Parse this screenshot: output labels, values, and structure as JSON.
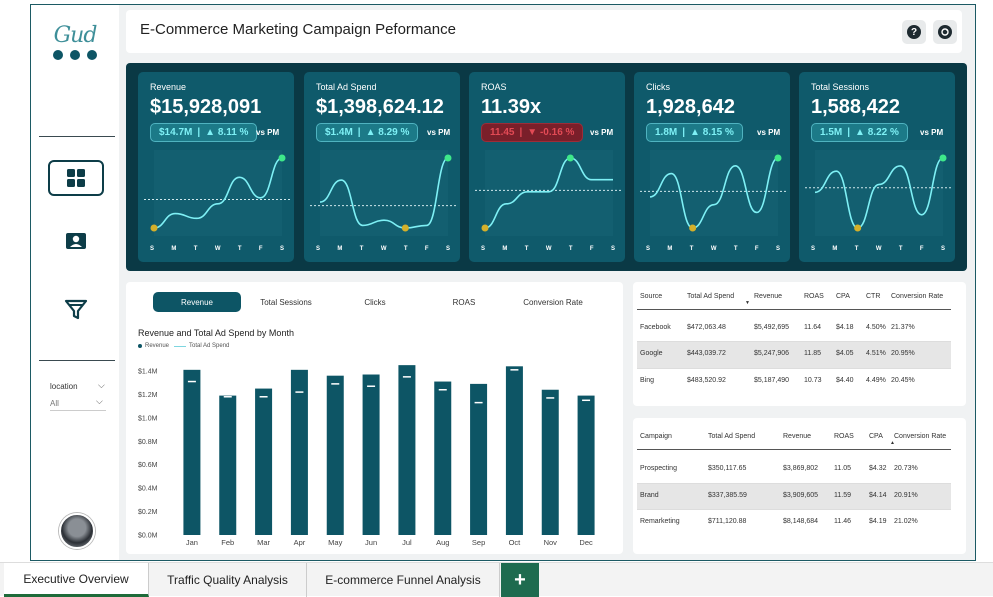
{
  "header": {
    "title": "E-Commerce Marketing Campaign Peformance",
    "help_icon": "?",
    "sync_icon": "sync"
  },
  "sidebar": {
    "logo_text": "Gud",
    "nav": [
      "dashboard-grid-icon",
      "profile-card-icon",
      "funnel-icon"
    ],
    "filter": {
      "label": "location",
      "value": "All"
    }
  },
  "kpis": [
    {
      "title": "Revenue",
      "value": "$15,928,091",
      "prev": "$14.7M",
      "change": "▲ 8.11 %",
      "vs": "vs PM",
      "trend": "positive",
      "series": [
        40,
        52,
        48,
        60,
        82,
        65,
        98
      ]
    },
    {
      "title": "Total Ad Spend",
      "value": "$1,398,624.12",
      "prev": "$1.4M",
      "change": "▲ 8.29 %",
      "vs": "vs PM",
      "trend": "positive",
      "series": [
        58,
        75,
        40,
        44,
        38,
        40,
        92
      ]
    },
    {
      "title": "ROAS",
      "value": "11.39x",
      "prev": "11.45",
      "change": "▼ -0.16 %",
      "vs": "vs PM",
      "trend": "negative",
      "series": [
        40,
        60,
        70,
        70,
        98,
        80,
        80
      ]
    },
    {
      "title": "Clicks",
      "value": "1,928,642",
      "prev": "1.8M",
      "change": "▲ 8.15 %",
      "vs": "vs PM",
      "trend": "positive",
      "series": [
        70,
        85,
        50,
        65,
        90,
        60,
        95
      ]
    },
    {
      "title": "Total Sessions",
      "value": "1,588,422",
      "prev": "1.5M",
      "change": "▲ 8.22 %",
      "vs": "vs PM",
      "trend": "positive",
      "series": [
        72,
        88,
        45,
        78,
        92,
        55,
        98
      ]
    }
  ],
  "days": [
    "S",
    "M",
    "T",
    "W",
    "T",
    "F",
    "S"
  ],
  "chart_tabs": [
    "Revenue",
    "Total Sessions",
    "Clicks",
    "ROAS",
    "Conversion Rate"
  ],
  "chart_data": {
    "type": "bar",
    "title": "Revenue and Total Ad Spend by Month",
    "legend": [
      "Revenue",
      "Total Ad Spend"
    ],
    "categories": [
      "Jan",
      "Feb",
      "Mar",
      "Apr",
      "May",
      "Jun",
      "Jul",
      "Aug",
      "Sep",
      "Oct",
      "Nov",
      "Dec"
    ],
    "series": [
      {
        "name": "Revenue",
        "values": [
          1.41,
          1.19,
          1.25,
          1.41,
          1.36,
          1.37,
          1.45,
          1.31,
          1.29,
          1.44,
          1.24,
          1.19
        ]
      },
      {
        "name": "Total Ad Spend",
        "values": [
          1.31,
          1.18,
          1.18,
          1.22,
          1.29,
          1.27,
          1.35,
          1.24,
          1.13,
          1.41,
          1.17,
          1.15
        ]
      }
    ],
    "yticks": [
      "$0.0M",
      "$0.2M",
      "$0.4M",
      "$0.6M",
      "$0.8M",
      "$1.0M",
      "$1.2M",
      "$1.4M"
    ],
    "ylim": [
      0,
      1.4
    ]
  },
  "source_table": {
    "headers": [
      "Source",
      "Total Ad Spend",
      "Revenue",
      "ROAS",
      "CPA",
      "CTR",
      "Conversion Rate"
    ],
    "rows": [
      [
        "Facebook",
        "$472,063.48",
        "$5,492,695",
        "11.64",
        "$4.18",
        "4.50%",
        "21.37%"
      ],
      [
        "Google",
        "$443,039.72",
        "$5,247,906",
        "11.85",
        "$4.05",
        "4.51%",
        "20.95%"
      ],
      [
        "Bing",
        "$483,520.92",
        "$5,187,490",
        "10.73",
        "$4.40",
        "4.49%",
        "20.45%"
      ]
    ]
  },
  "campaign_table": {
    "headers": [
      "Campaign",
      "Total Ad Spend",
      "Revenue",
      "ROAS",
      "CPA",
      "Conversion Rate"
    ],
    "rows": [
      [
        "Prospecting",
        "$350,117.65",
        "$3,869,802",
        "11.05",
        "$4.32",
        "20.73%"
      ],
      [
        "Brand",
        "$337,385.59",
        "$3,909,605",
        "11.59",
        "$4.14",
        "20.91%"
      ],
      [
        "Remarketing",
        "$711,120.88",
        "$8,148,684",
        "11.46",
        "$4.19",
        "21.02%"
      ]
    ]
  },
  "page_tabs": [
    "Executive Overview",
    "Traffic Quality Analysis",
    "E-commerce Funnel Analysis"
  ],
  "add_tab": "+",
  "colors": {
    "accent": "#0d5565",
    "band": "#0a3945",
    "card": "#0f5a6b",
    "line": "#7ef0f5",
    "start_dot": "#d4b02a",
    "end_dot": "#3ee88a"
  }
}
